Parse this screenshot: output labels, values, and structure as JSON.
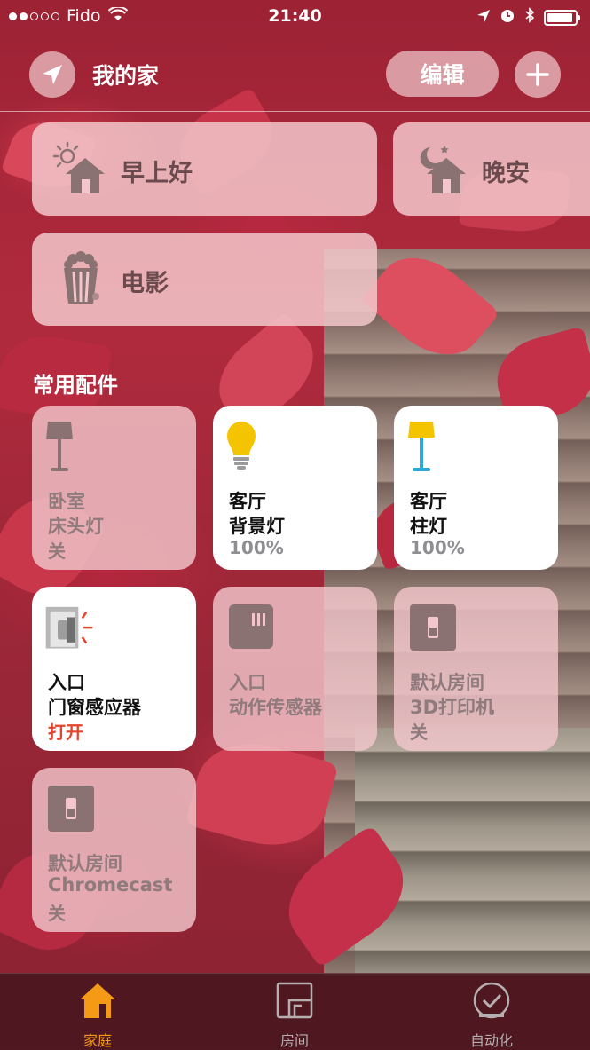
{
  "status_bar": {
    "carrier": "Fido",
    "time": "21:40",
    "signal_bars": 2,
    "battery_level": 0.85
  },
  "header": {
    "title": "我的家",
    "edit_label": "编辑",
    "location_icon": "location-arrow-icon",
    "add_icon": "plus-icon"
  },
  "scenes": [
    {
      "label": "早上好",
      "icon": "sunrise-home-icon"
    },
    {
      "label": "晚安",
      "icon": "moon-home-icon"
    },
    {
      "label": "电影",
      "icon": "popcorn-icon"
    }
  ],
  "section_title": "常用配件",
  "accessories": [
    {
      "room": "卧室",
      "name": "床头灯",
      "status": "关",
      "state": "off",
      "icon": "table-lamp-icon"
    },
    {
      "room": "客厅",
      "name": "背景灯",
      "status": "100%",
      "state": "on",
      "icon": "light-bulb-icon"
    },
    {
      "room": "客厅",
      "name": "柱灯",
      "status": "100%",
      "state": "on",
      "icon": "floor-lamp-icon"
    },
    {
      "room": "入口",
      "name": "门窗感应器",
      "status": "打开",
      "state": "open",
      "icon": "door-sensor-icon"
    },
    {
      "room": "入口",
      "name": "动作传感器",
      "status": "",
      "state": "off",
      "icon": "motion-sensor-icon"
    },
    {
      "room": "默认房间",
      "name": "3D打印机",
      "status": "关",
      "state": "off",
      "icon": "outlet-icon"
    },
    {
      "room": "默认房间",
      "name": "Chromecast",
      "status": "关",
      "state": "off",
      "icon": "outlet-icon"
    }
  ],
  "tabs": [
    {
      "label": "家庭",
      "active": true,
      "icon": "home-icon"
    },
    {
      "label": "房间",
      "active": false,
      "icon": "rooms-icon"
    },
    {
      "label": "自动化",
      "active": false,
      "icon": "automation-clock-icon"
    }
  ],
  "colors": {
    "accent": "#f59a14",
    "open_status": "#e5452f",
    "tile_off": "#f2c6ca",
    "tile_on": "#ffffff"
  }
}
